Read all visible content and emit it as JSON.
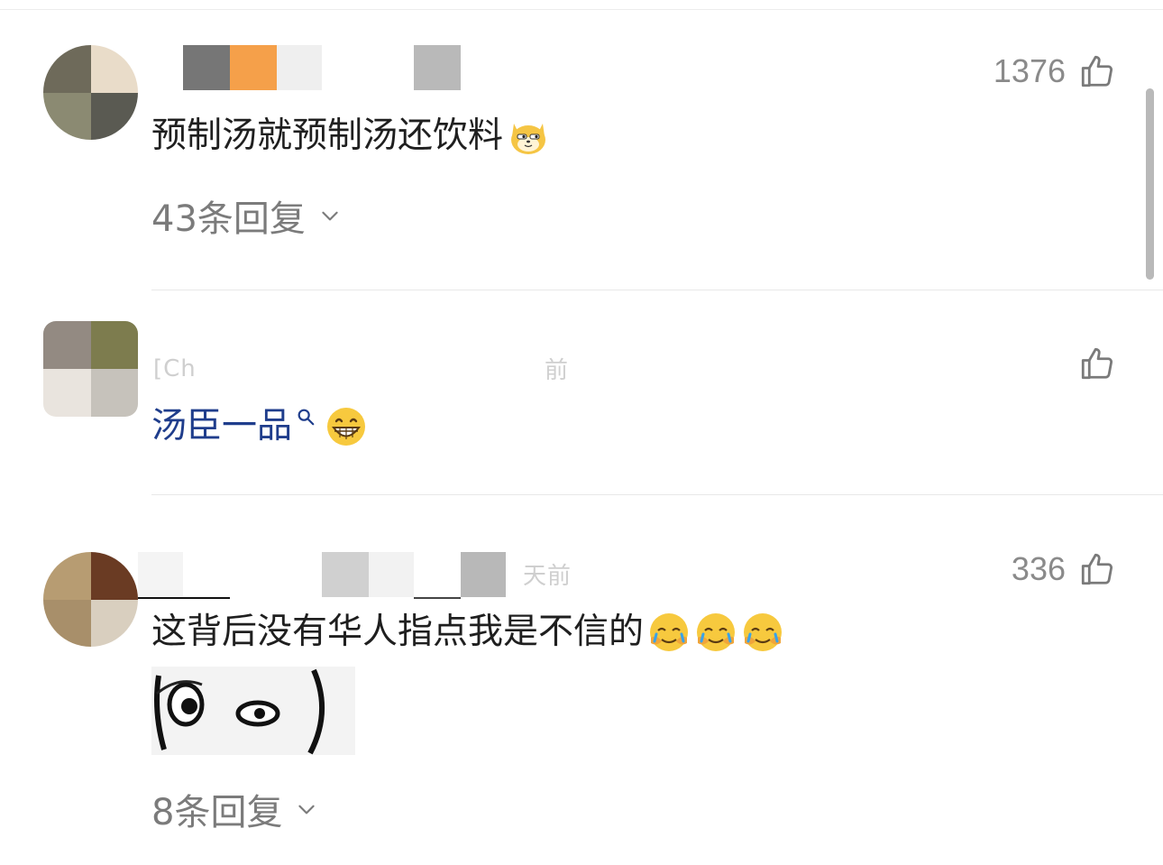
{
  "comments": [
    {
      "likes": "1376",
      "text": "预制汤就预制汤还饮料",
      "emoji": "cat-emoji",
      "replies": "43条回复"
    },
    {
      "likes": "",
      "username_fragment": "[Ch",
      "time_fragment": "前",
      "link_text": "汤臣一品",
      "emoji": "grin-emoji"
    },
    {
      "likes": "336",
      "time_fragment": "天前",
      "text": "这背后没有华人指点我是不信的",
      "emoji": "facepalm-emoji",
      "replies": "8条回复"
    }
  ],
  "colors": {
    "link": "#1f3d8c",
    "muted": "#7b7b7b",
    "divider": "#e8e8e8"
  },
  "icons": [
    "thumb-up-icon",
    "chevron-down-icon",
    "search-icon"
  ]
}
